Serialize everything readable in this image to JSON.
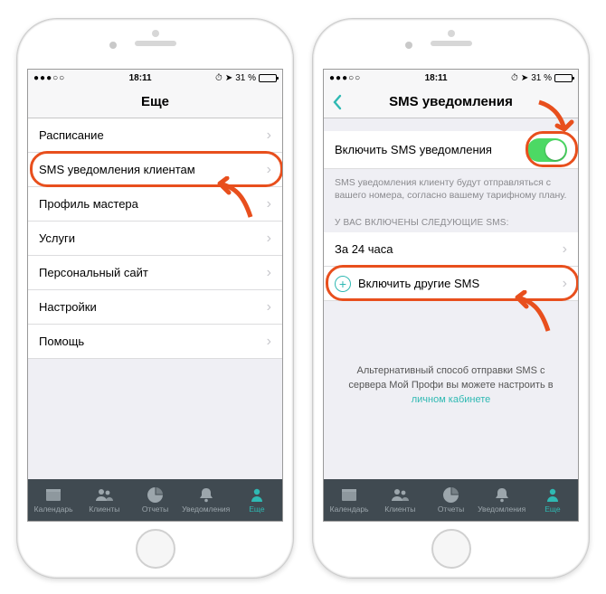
{
  "status": {
    "time": "18:11",
    "battery_pct": "31 %",
    "signal": "●●●○○"
  },
  "left": {
    "nav_title": "Еще",
    "menu": [
      "Расписание",
      "SMS уведомления клиентам",
      "Профиль мастера",
      "Услуги",
      "Персональный сайт",
      "Настройки",
      "Помощь"
    ]
  },
  "right": {
    "nav_title": "SMS уведомления",
    "enable_row_label": "Включить SMS уведомления",
    "enable_row_on": true,
    "note": "SMS уведомления клиенту будут отправляться с вашего номера, согласно вашему тарифному плану.",
    "section_header": "У ВАС ВКЛЮЧЕНЫ СЛЕДУЮЩИЕ SMS:",
    "enabled_sms": [
      "За 24 часа"
    ],
    "add_row_label": "Включить другие SMS",
    "alt_text_pre": "Альтернативный способ отправки SMS с сервера Мой Профи вы можете настроить в ",
    "alt_text_link": "личном кабинете"
  },
  "tabs": [
    {
      "id": "calendar",
      "label": "Календарь"
    },
    {
      "id": "clients",
      "label": "Клиенты"
    },
    {
      "id": "reports",
      "label": "Отчеты"
    },
    {
      "id": "notifications",
      "label": "Уведомления"
    },
    {
      "id": "more",
      "label": "Еще"
    }
  ],
  "colors": {
    "accent": "#2fb9b3",
    "highlight": "#e84f1d"
  }
}
